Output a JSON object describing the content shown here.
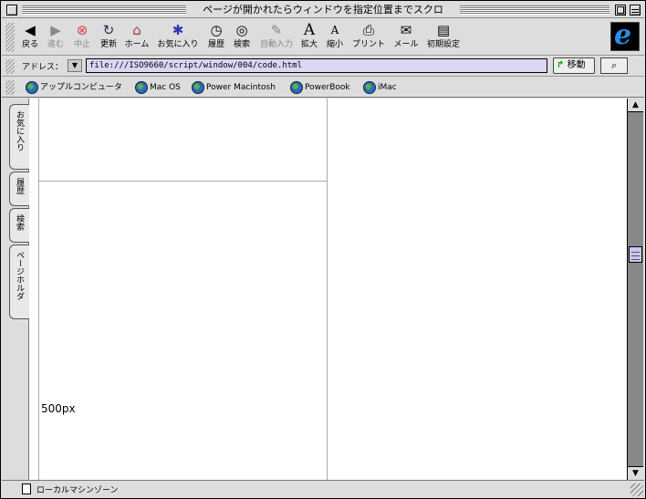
{
  "window": {
    "title": "ページが開かれたらウィンドウを指定位置までスクロ"
  },
  "toolbar": {
    "back": "戻る",
    "forward": "進む",
    "stop": "中止",
    "refresh": "更新",
    "home": "ホーム",
    "favorites": "お気に入り",
    "history": "履歴",
    "search": "検索",
    "autofill": "自動入力",
    "larger": "拡大",
    "smaller": "縮小",
    "print": "プリント",
    "mail": "メール",
    "preferences": "初期設定"
  },
  "address": {
    "label": "アドレス：",
    "url": "file:///ISO9660/script/window/004/code.html",
    "go_label": "移動"
  },
  "favorites_bar": {
    "items": [
      "アップルコンピュータ",
      "Mac OS",
      "Power Macintosh",
      "PowerBook",
      "iMac"
    ]
  },
  "side_tabs": {
    "items": [
      "お気に入り",
      "履歴",
      "検索",
      "ページホルダ"
    ]
  },
  "content": {
    "label": "500px"
  },
  "status": {
    "zone": "ローカルマシンゾーン"
  },
  "colors": {
    "address_bg": "#d9d7f3",
    "scroll_thumb": "#c9c7ee",
    "ie_blue": "#2a8de6"
  }
}
